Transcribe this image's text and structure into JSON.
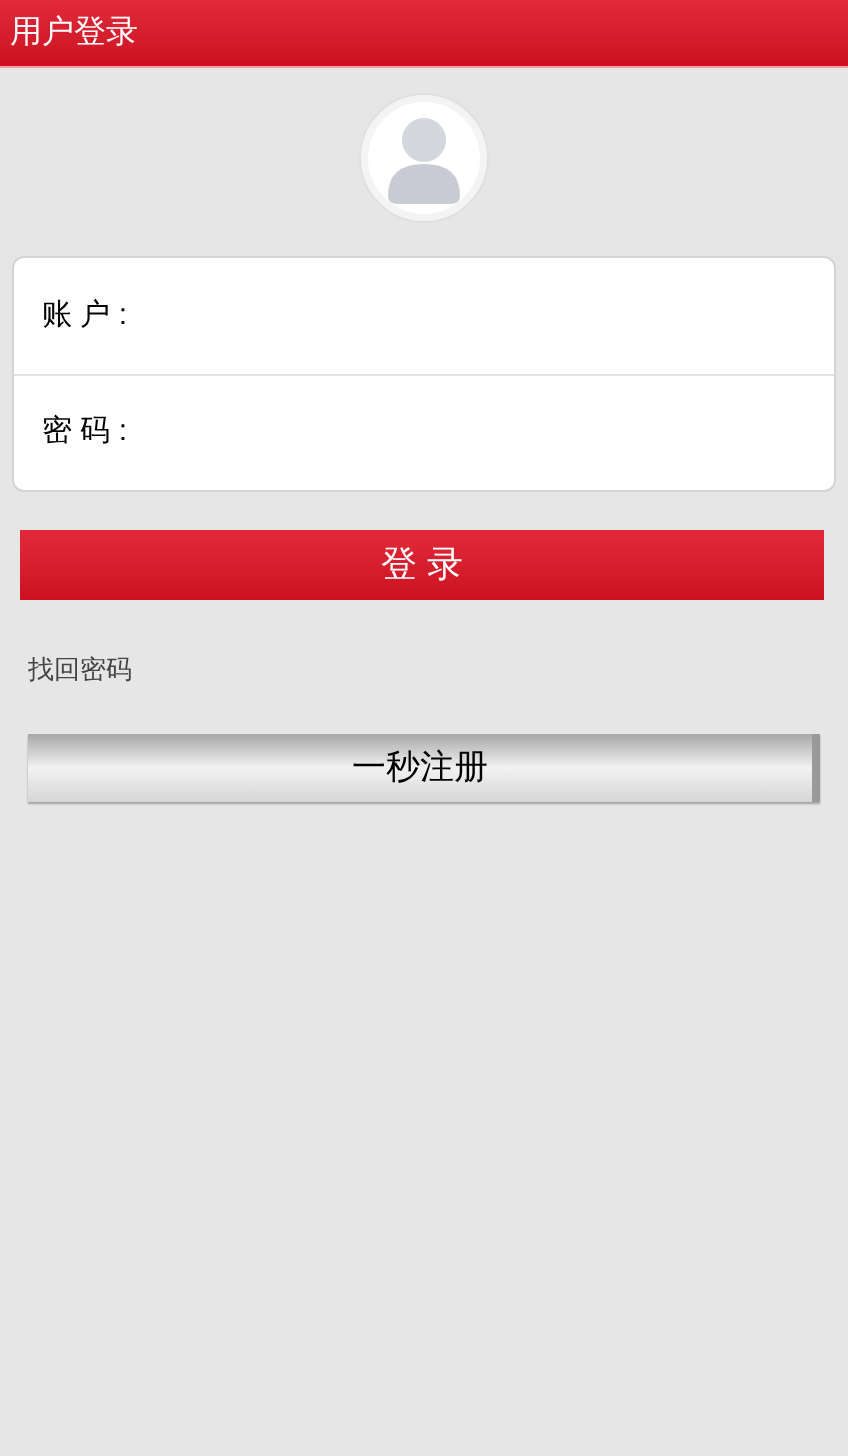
{
  "title_bar": {
    "title": "用户登录"
  },
  "form": {
    "fields": [
      {
        "label": "账 户 :"
      },
      {
        "label": "密 码 :"
      }
    ]
  },
  "login_button": "登 录",
  "forgot_password_link": "找回密码",
  "register_button": "一秒注册"
}
